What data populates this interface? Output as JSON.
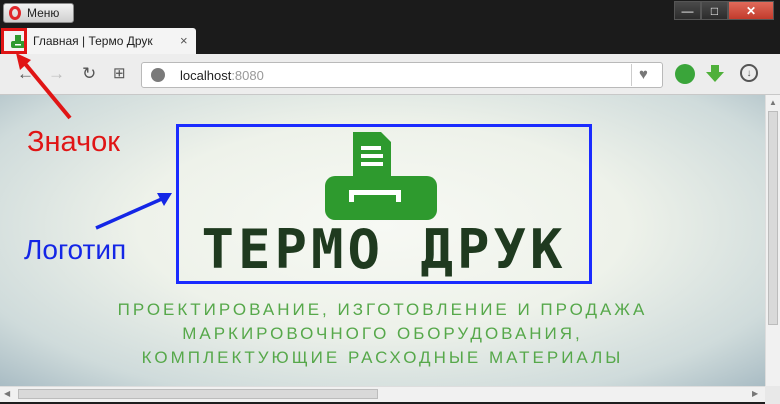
{
  "window": {
    "menu_label": "Меню",
    "controls": {
      "minimize": "—",
      "maximize": "□",
      "close": "✕"
    }
  },
  "tab": {
    "title": "Главная | Термо Друк",
    "close": "×",
    "new_tab": "+"
  },
  "toolbar": {
    "back": "←",
    "forward": "→",
    "reload": "↻",
    "speed_dial": "⊞"
  },
  "address": {
    "host": "localhost",
    "port": ":8080"
  },
  "page": {
    "logo_text": "ТЕРМО ДРУК",
    "tagline": [
      "ПРОЕКТИРОВАНИЕ, ИЗГОТОВЛЕНИЕ И ПРОДАЖА",
      "МАРКИРОВОЧНОГО ОБОРУДОВАНИЯ,",
      "КОМПЛЕКТУЮЩИЕ РАСХОДНЫЕ МАТЕРИАЛЫ"
    ]
  },
  "annotations": {
    "icon_label": "Значок",
    "logo_label": "Логотип",
    "icon_color": "#e01515",
    "logo_color": "#1426e6"
  },
  "colors": {
    "brand_green": "#2e9a2e",
    "logo_text": "#1f3a1f",
    "tagline": "#56a84a"
  }
}
